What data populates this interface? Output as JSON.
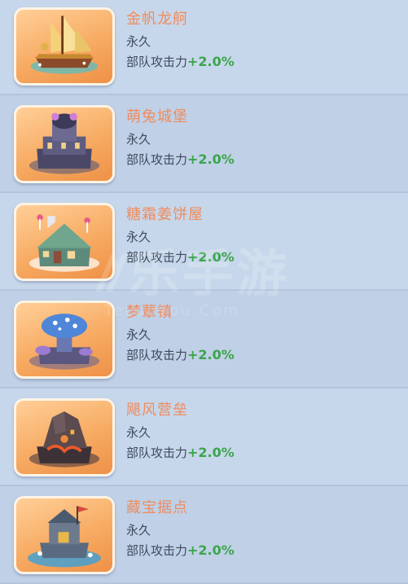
{
  "items": [
    {
      "name": "金帆龙舸",
      "duration": "永久",
      "bonus_label": "部队攻击力",
      "bonus_value": "+2.0%",
      "icon": "golden-ship-icon"
    },
    {
      "name": "萌兔城堡",
      "duration": "永久",
      "bonus_label": "部队攻击力",
      "bonus_value": "+2.0%",
      "icon": "bunny-castle-icon"
    },
    {
      "name": "糖霜姜饼屋",
      "duration": "永久",
      "bonus_label": "部队攻击力",
      "bonus_value": "+2.0%",
      "icon": "gingerbread-house-icon"
    },
    {
      "name": "梦蕈镇",
      "duration": "永久",
      "bonus_label": "部队攻击力",
      "bonus_value": "+2.0%",
      "icon": "mushroom-town-icon"
    },
    {
      "name": "飓风营垒",
      "duration": "永久",
      "bonus_label": "部队攻击力",
      "bonus_value": "+2.0%",
      "icon": "hurricane-fortress-icon"
    },
    {
      "name": "藏宝据点",
      "duration": "永久",
      "bonus_label": "部队攻击力",
      "bonus_value": "+2.0%",
      "icon": "treasure-stronghold-icon"
    }
  ],
  "watermark": {
    "main": "ꥀ乐手游",
    "sub": "TeLuoyou.Com"
  },
  "colors": {
    "name": "#ee8c5f",
    "bonus_value": "#3aa64a",
    "text": "#3e4a5c",
    "thumb_bg": "#f7ab63"
  }
}
